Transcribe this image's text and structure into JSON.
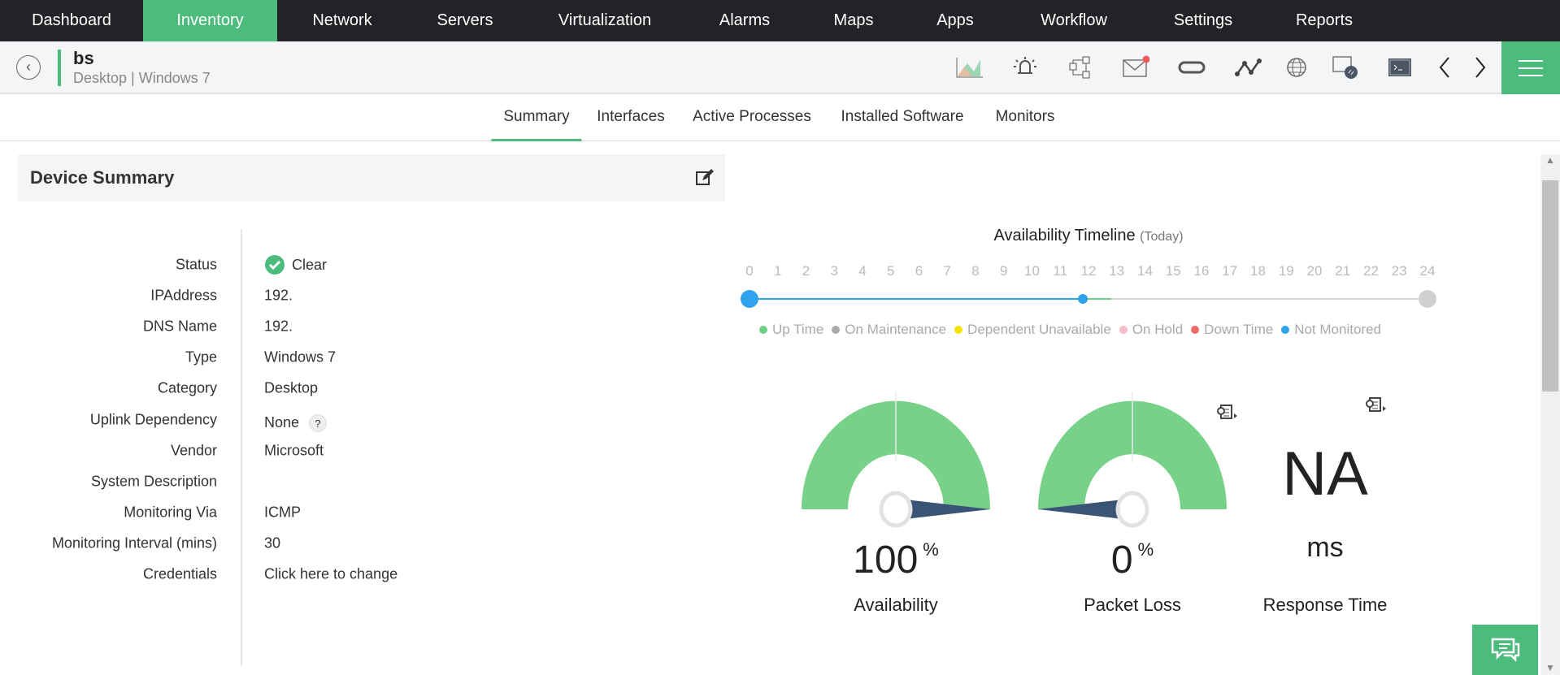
{
  "nav": {
    "items": [
      "Dashboard",
      "Inventory",
      "Network",
      "Servers",
      "Virtualization",
      "Alarms",
      "Maps",
      "Apps",
      "Workflow",
      "Settings",
      "Reports"
    ],
    "active": "Inventory"
  },
  "device": {
    "name": "bs",
    "subtitle": "Desktop | Windows 7"
  },
  "toolbar": {
    "icons": [
      "graph-icon",
      "alarm-bell-icon",
      "workflow-icon",
      "mail-icon",
      "sync-icon",
      "path-icon",
      "globe-icon",
      "remote-desktop-icon",
      "terminal-icon",
      "previous-icon",
      "next-icon",
      "menu-icon"
    ]
  },
  "tabs": [
    "Summary",
    "Interfaces",
    "Active Processes",
    "Installed Software",
    "Monitors"
  ],
  "summary": {
    "title": "Device Summary",
    "rows": [
      {
        "label": "Status",
        "value": "Clear"
      },
      {
        "label": "IPAddress",
        "value": "192."
      },
      {
        "label": "DNS Name",
        "value": "192."
      },
      {
        "label": "Type",
        "value": "Windows 7"
      },
      {
        "label": "Category",
        "value": "Desktop"
      },
      {
        "label": "Uplink Dependency",
        "value": "None"
      },
      {
        "label": "Vendor",
        "value": "Microsoft"
      },
      {
        "label": "System Description",
        "value": ""
      },
      {
        "label": "Monitoring Via",
        "value": "ICMP"
      },
      {
        "label": "Monitoring Interval (mins)",
        "value": "30"
      },
      {
        "label": "Credentials",
        "value": "Click here to change"
      }
    ]
  },
  "timeline": {
    "title": "Availability Timeline",
    "period": "(Today)",
    "hours": [
      "0",
      "1",
      "2",
      "3",
      "4",
      "5",
      "6",
      "7",
      "8",
      "9",
      "10",
      "11",
      "12",
      "13",
      "14",
      "15",
      "16",
      "17",
      "18",
      "19",
      "20",
      "21",
      "22",
      "23",
      "24"
    ],
    "segments": [
      {
        "status": "Not Monitored",
        "from": 0,
        "to": 11.8
      },
      {
        "status": "Up Time",
        "from": 11.8,
        "to": 12.8
      }
    ],
    "legend": [
      {
        "label": "Up Time",
        "color": "#6fcf86"
      },
      {
        "label": "On Maintenance",
        "color": "#aaaaaa"
      },
      {
        "label": "Dependent Unavailable",
        "color": "#f5e400"
      },
      {
        "label": "On Hold",
        "color": "#f8bdc8"
      },
      {
        "label": "Down Time",
        "color": "#ee6a6a"
      },
      {
        "label": "Not Monitored",
        "color": "#2fa3ee"
      }
    ]
  },
  "gauges": [
    {
      "label": "Availability",
      "value": 100,
      "display": "100",
      "unit": "%"
    },
    {
      "label": "Packet Loss",
      "value": 0,
      "display": "0",
      "unit": "%"
    }
  ],
  "response": {
    "value": "NA",
    "unit": "ms",
    "label": "Response Time"
  },
  "colors": {
    "accent": "#4cbc7c",
    "gauge": "#77d189",
    "needle": "#3a5478"
  }
}
